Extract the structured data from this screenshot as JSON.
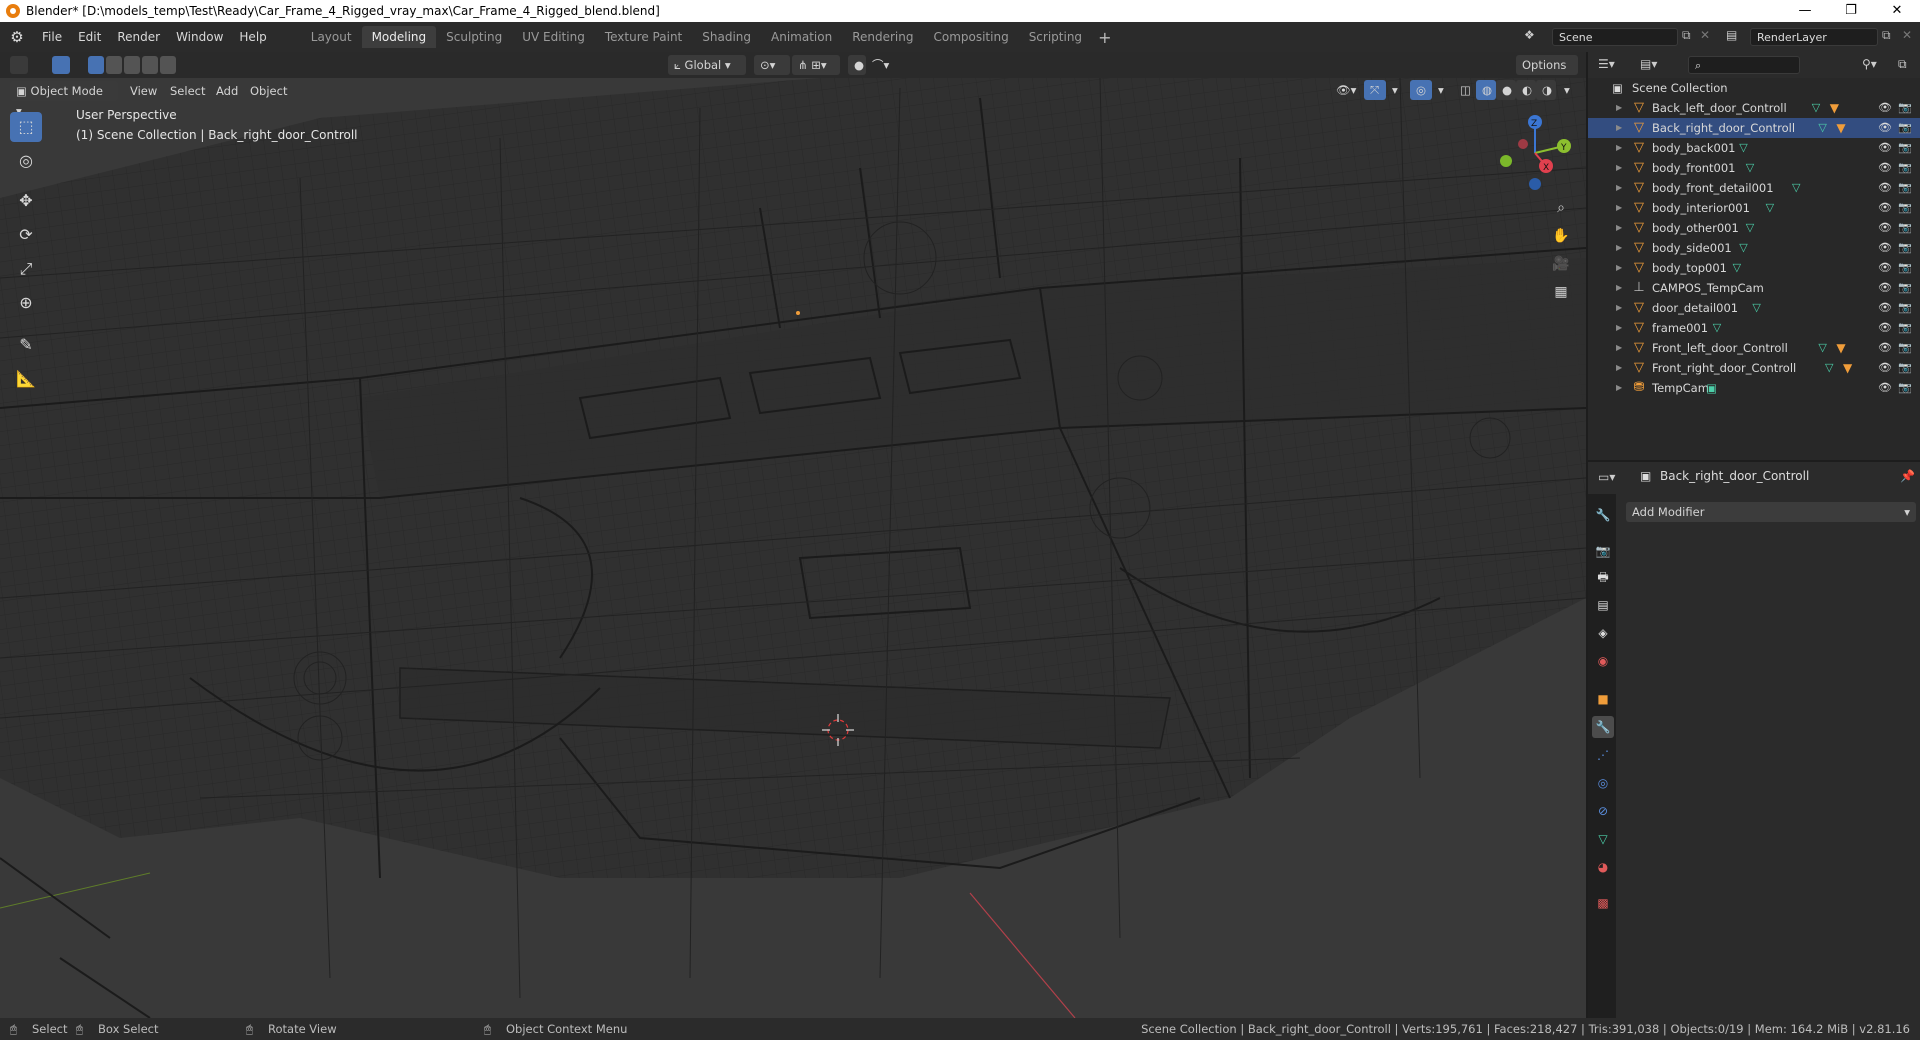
{
  "window": {
    "title": "Blender* [D:\\models_temp\\Test\\Ready\\Car_Frame_4_Rigged_vray_max\\Car_Frame_4_Rigged_blend.blend]",
    "controls": [
      "—",
      "❐",
      "✕"
    ]
  },
  "menu": {
    "items": [
      "File",
      "Edit",
      "Render",
      "Window",
      "Help"
    ]
  },
  "workspaces": {
    "tabs": [
      "Layout",
      "Modeling",
      "Sculpting",
      "UV Editing",
      "Texture Paint",
      "Shading",
      "Animation",
      "Rendering",
      "Compositing",
      "Scripting"
    ],
    "active": "Modeling",
    "add": "+"
  },
  "scene": {
    "name": "Scene",
    "render_layer": "RenderLayer"
  },
  "viewport_header": {
    "transform_orientation": "Global",
    "options_label": "Options",
    "mode": "Object Mode",
    "menus": [
      "View",
      "Select",
      "Add",
      "Object"
    ]
  },
  "viewport": {
    "perspective_label": "User Perspective",
    "context_label": "(1) Scene Collection | Back_right_door_Controll",
    "gizmo": {
      "x": "X",
      "y": "Y",
      "z": "Z"
    }
  },
  "outliner": {
    "root": "Scene Collection",
    "items": [
      {
        "name": "Back_left_door_Controll",
        "selected": false
      },
      {
        "name": "Back_right_door_Controll",
        "selected": true
      },
      {
        "name": "body_back001",
        "selected": false
      },
      {
        "name": "body_front001",
        "selected": false
      },
      {
        "name": "body_front_detail001",
        "selected": false
      },
      {
        "name": "body_interior001",
        "selected": false
      },
      {
        "name": "body_other001",
        "selected": false
      },
      {
        "name": "body_side001",
        "selected": false
      },
      {
        "name": "body_top001",
        "selected": false
      },
      {
        "name": "CAMPOS_TempCam",
        "selected": false
      },
      {
        "name": "door_detail001",
        "selected": false
      },
      {
        "name": "frame001",
        "selected": false
      },
      {
        "name": "Front_left_door_Controll",
        "selected": false
      },
      {
        "name": "Front_right_door_Controll",
        "selected": false
      },
      {
        "name": "TempCam",
        "selected": false
      }
    ]
  },
  "properties": {
    "object_name": "Back_right_door_Controll",
    "add_modifier_label": "Add Modifier"
  },
  "statusbar": {
    "select": "Select",
    "box_select": "Box Select",
    "rotate_view": "Rotate View",
    "context_menu": "Object Context Menu",
    "stats": "Scene Collection | Back_right_door_Controll | Verts:195,761 | Faces:218,427 | Tris:391,038 | Objects:0/19 | Mem: 164.2 MiB | v2.81.16"
  },
  "colors": {
    "accent": "#4772b3",
    "active_object": "#f09d3a",
    "mesh_data": "#4ccfa9"
  }
}
